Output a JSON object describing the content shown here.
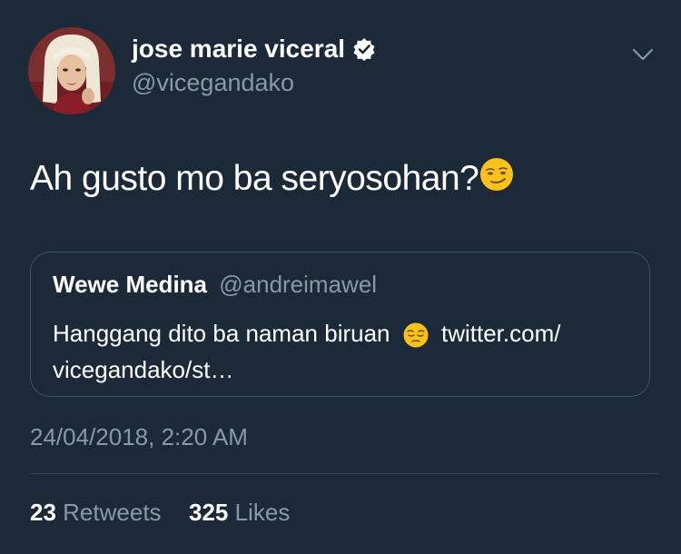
{
  "tweet": {
    "author_name": "jose marie viceral",
    "author_handle": "@vicegandako",
    "text": "Ah gusto mo ba seryosohan?",
    "emoji": "smirking-face",
    "timestamp": "24/04/2018, 2:20 AM"
  },
  "quoted_tweet": {
    "author_name": "Wewe Medina",
    "author_handle": "@andreimawel",
    "text_before_emoji": "Hanggang dito ba naman biruan",
    "emoji": "pensive-face",
    "text_after_emoji": "twitter.com/",
    "text_line2": "vicegandako/st…"
  },
  "stats": {
    "retweets_count": "23",
    "retweets_label": "Retweets",
    "likes_count": "325",
    "likes_label": "Likes"
  },
  "colors": {
    "background": "#1c2938",
    "muted_text": "#8899a6",
    "border": "#3d5466",
    "divider": "#38444d"
  }
}
